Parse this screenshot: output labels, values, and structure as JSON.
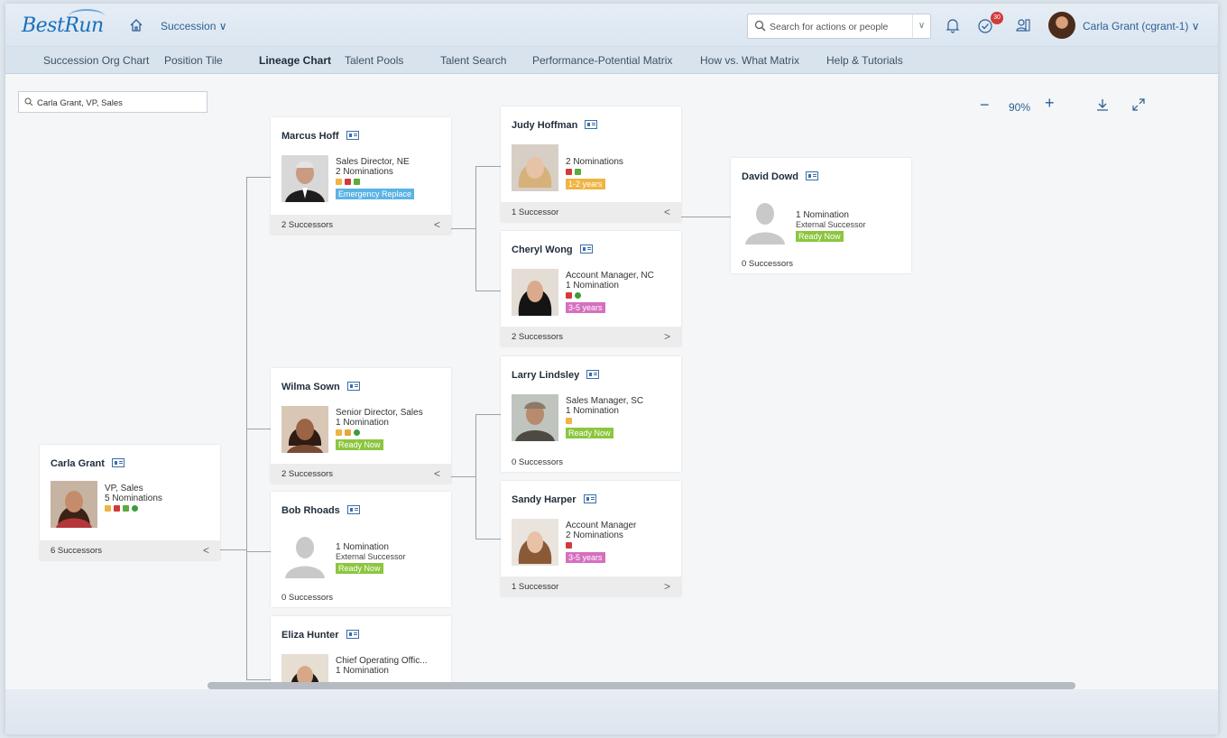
{
  "shell": {
    "logo": "BestRun",
    "app_menu": "Succession ∨",
    "search_placeholder": "Search for actions or people",
    "notification_badge": "30",
    "user_name": "Carla Grant (cgrant-1) ∨"
  },
  "subnav": [
    {
      "label": "Succession Org Chart",
      "active": false
    },
    {
      "label": "Position Tile",
      "active": false
    },
    {
      "label": "Lineage Chart",
      "active": true
    },
    {
      "label": "Talent Pools",
      "active": false
    },
    {
      "label": "Talent Search",
      "active": false
    },
    {
      "label": "Performance-Potential Matrix",
      "active": false
    },
    {
      "label": "How vs. What Matrix",
      "active": false
    },
    {
      "label": "Help & Tutorials",
      "active": false
    }
  ],
  "toolbar": {
    "filter_value": "Carla Grant, VP, Sales",
    "zoom_out": "−",
    "zoom_level": "90%",
    "zoom_in": "+"
  },
  "cards": {
    "carla": {
      "name": "Carla Grant",
      "title": "VP, Sales",
      "nominations": "5 Nominations",
      "successors": "6 Successors",
      "chevron": "<"
    },
    "marcus": {
      "name": "Marcus Hoff",
      "title": "Sales Director, NE",
      "nominations": "2 Nominations",
      "tag": "Emergency Replace",
      "successors": "2 Successors",
      "chevron": "<"
    },
    "wilma": {
      "name": "Wilma Sown",
      "title": "Senior Director, Sales",
      "nominations": "1 Nomination",
      "tag": "Ready Now",
      "successors": "2 Successors",
      "chevron": "<"
    },
    "bob": {
      "name": "Bob Rhoads",
      "nominations": "1 Nomination",
      "subtitle": "External Successor",
      "tag": "Ready Now",
      "successors": "0 Successors"
    },
    "eliza": {
      "name": "Eliza Hunter",
      "title": "Chief Operating Offic...",
      "nominations": "1 Nomination"
    },
    "judy": {
      "name": "Judy Hoffman",
      "nominations": "2 Nominations",
      "tag": "1-2 years",
      "successors": "1 Successor",
      "chevron": "<"
    },
    "cheryl": {
      "name": "Cheryl Wong",
      "title": "Account Manager, NC",
      "nominations": "1 Nomination",
      "tag": "3-5 years",
      "successors": "2 Successors",
      "chevron": ">"
    },
    "larry": {
      "name": "Larry Lindsley",
      "title": "Sales Manager, SC",
      "nominations": "1 Nomination",
      "tag": "Ready Now",
      "successors": "0 Successors"
    },
    "sandy": {
      "name": "Sandy Harper",
      "title": "Account Manager",
      "nominations": "2 Nominations",
      "tag": "3-5 years",
      "successors": "1 Successor",
      "chevron": ">"
    },
    "david": {
      "name": "David Dowd",
      "nominations": "1 Nomination",
      "subtitle": "External Successor",
      "tag": "Ready Now",
      "successors": "0 Successors"
    }
  },
  "colors": {
    "ready_now": "#8cc63f",
    "emergency": "#5ab3e6",
    "one_two_years": "#f0b443",
    "three_five_years": "#d66fbf",
    "accent": "#2c5f95"
  }
}
